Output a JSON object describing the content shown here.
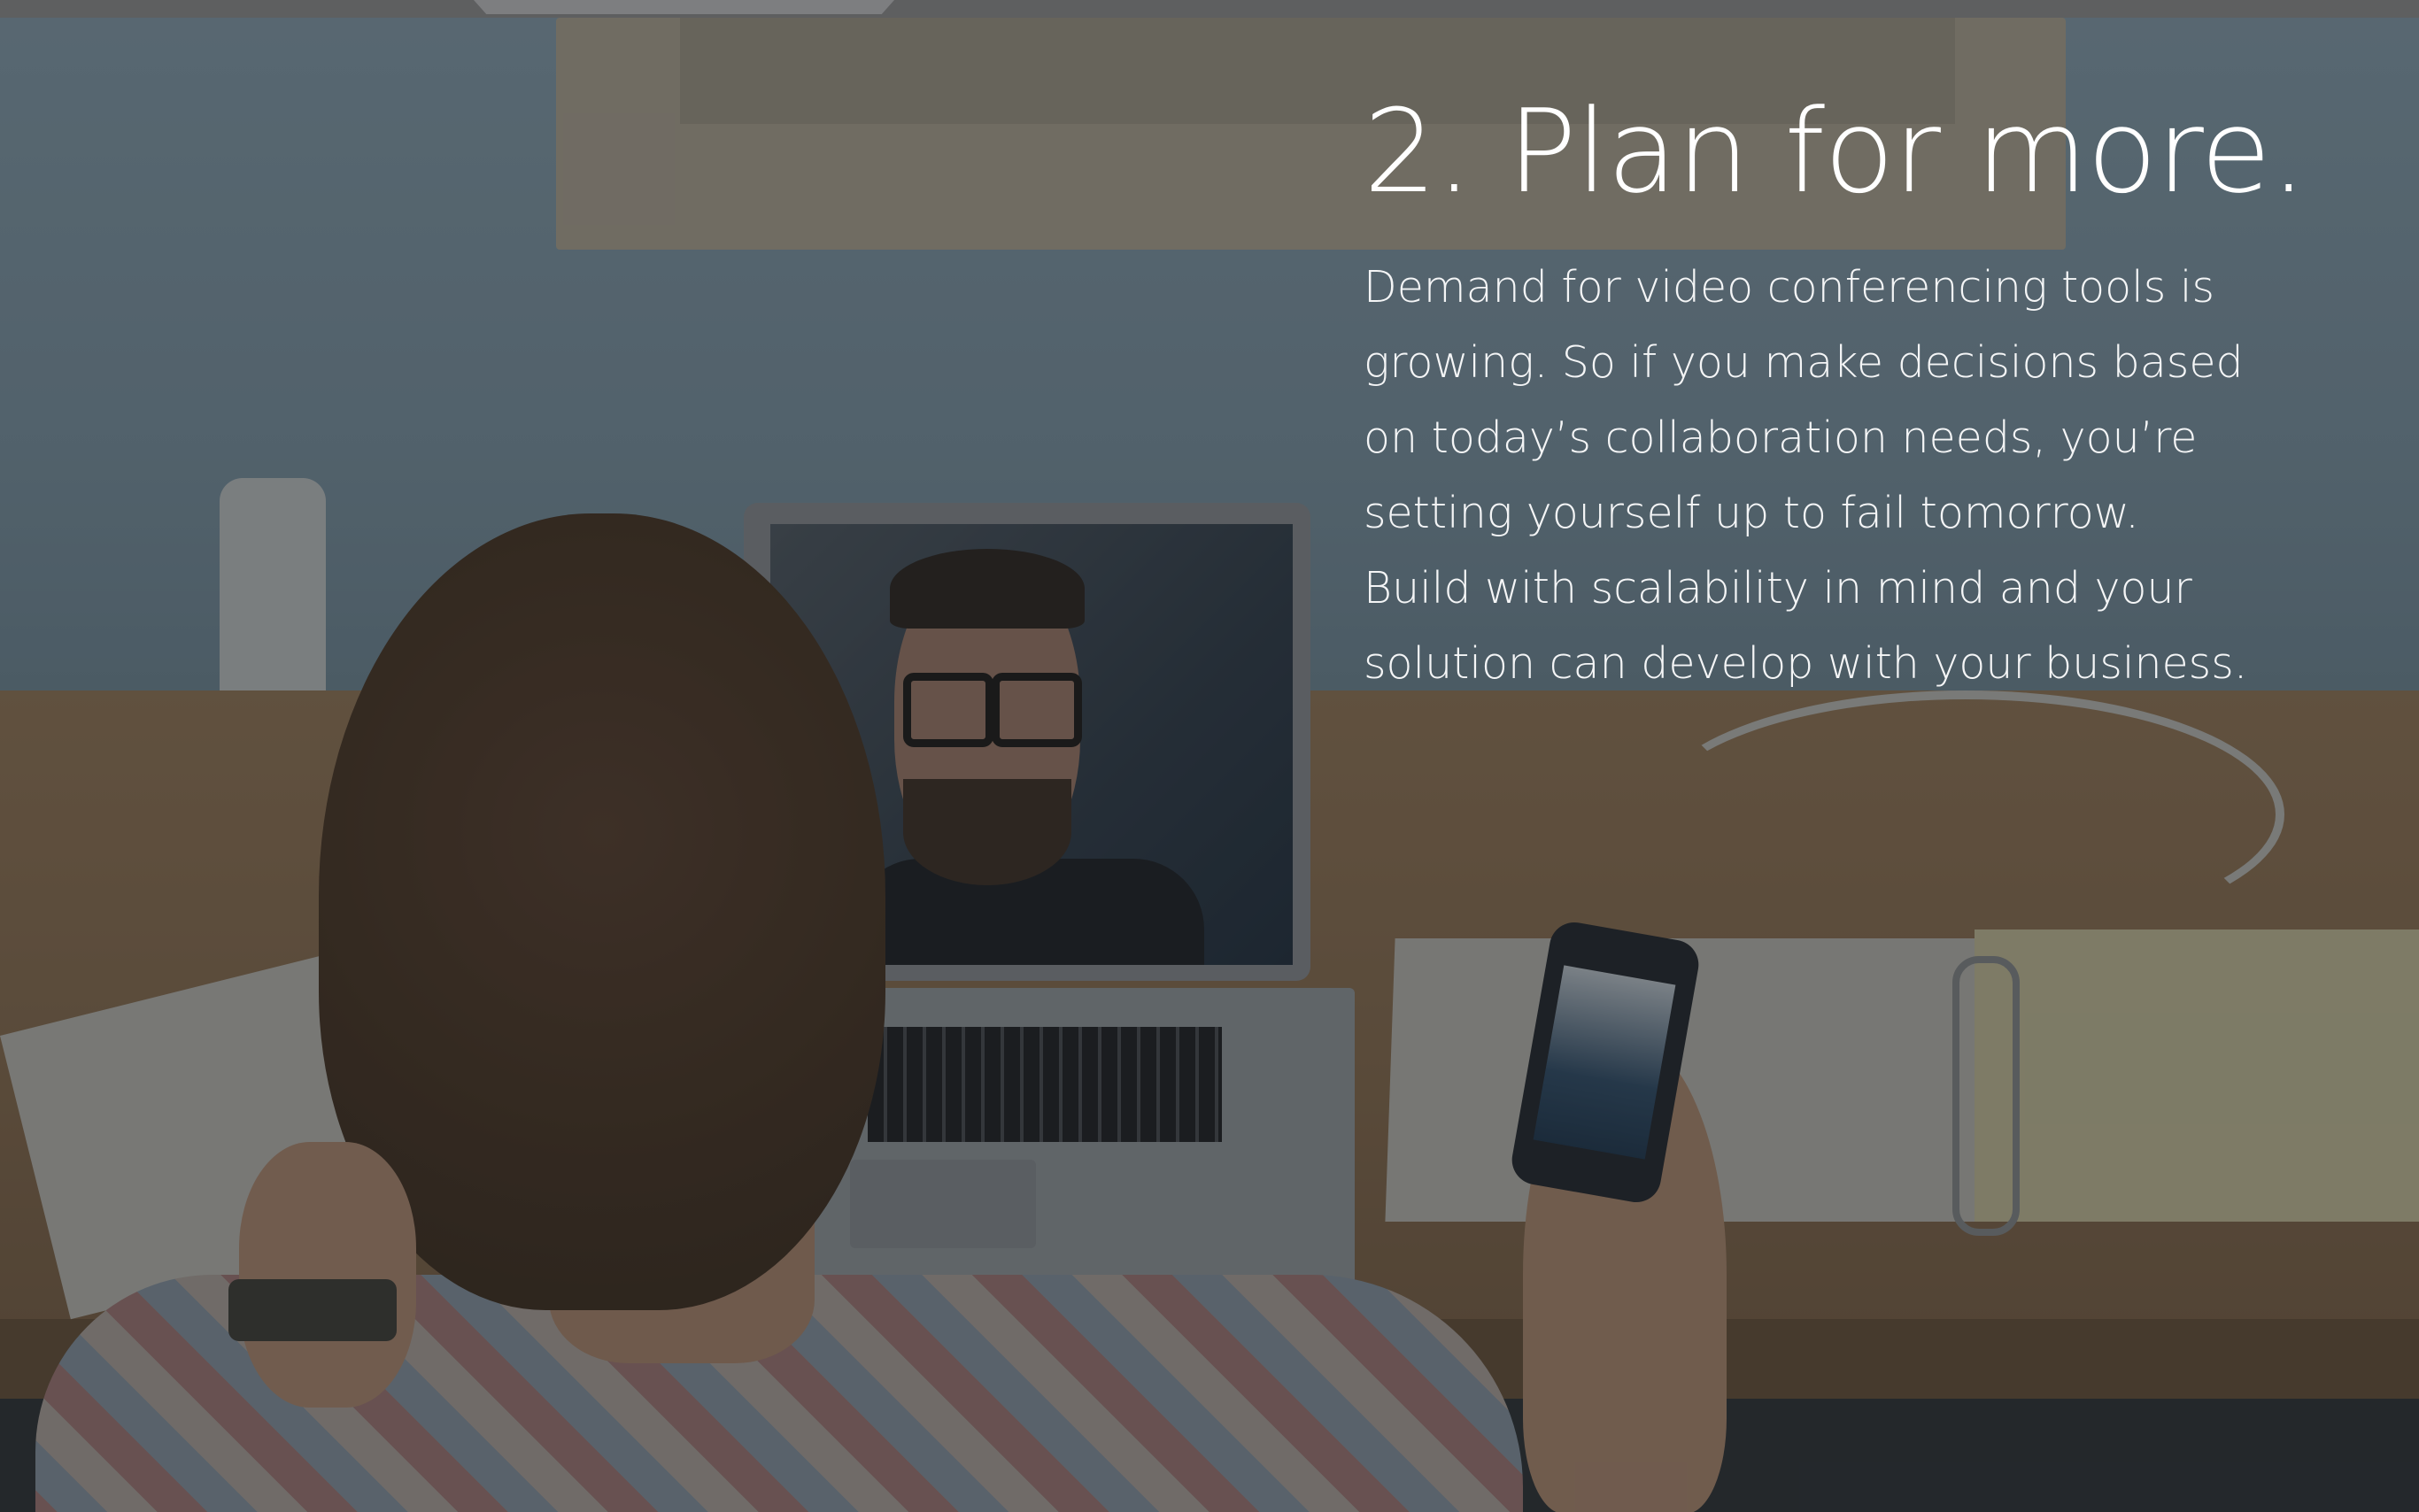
{
  "slide": {
    "heading": "2. Plan for more.",
    "body_lines": [
      "Demand for video conferencing tools is",
      "growing. So if you make decisions based",
      "on today’s collaboration needs, you’re",
      "setting yourself up to fail tomorrow.",
      "Build with scalability in mind and your",
      "solution can develop with your business."
    ],
    "text_color": "#ffffff",
    "overlay_color": "#1a1e22"
  }
}
